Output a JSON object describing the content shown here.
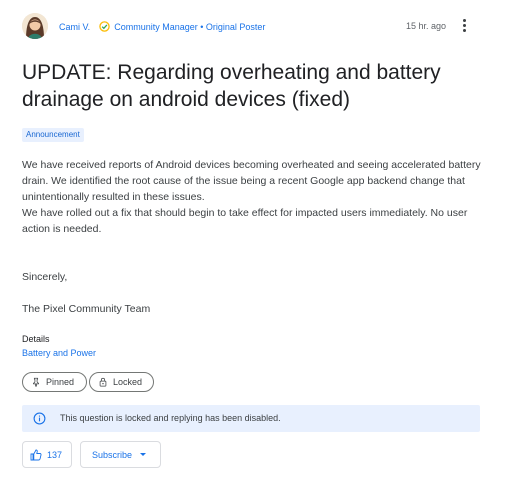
{
  "post": {
    "author": "Cami V.",
    "role": "Community Manager • Original Poster",
    "time": "15 hr. ago",
    "title": "UPDATE: Regarding overheating and battery drainage on android devices (fixed)",
    "tag": "Announcement",
    "body_p1": "We have received reports of Android devices becoming overheated and seeing accelerated battery drain. We identified the root cause of the issue being a recent Google app backend change that unintentionally resulted in these issues.",
    "body_p2": "We have rolled out a fix that should begin to take effect for impacted users immediately. No user action is needed.",
    "sign_off": "Sincerely,",
    "signature": "The Pixel Community Team"
  },
  "details": {
    "label": "Details",
    "category": "Battery and Power"
  },
  "status_chips": {
    "pinned": "Pinned",
    "locked": "Locked"
  },
  "notice": {
    "text": "This question is locked and replying has been disabled."
  },
  "actions": {
    "like_count": "137",
    "subscribe": "Subscribe"
  },
  "colors": {
    "accent": "#1a73e8",
    "notice_bg": "#e8f0fe",
    "verified_badge": "#34a853"
  },
  "icons": [
    "avatar",
    "verified-badge-icon",
    "more-vert-icon",
    "pin-icon",
    "lock-icon",
    "info-icon",
    "thumb-up-icon",
    "chevron-down-icon"
  ]
}
